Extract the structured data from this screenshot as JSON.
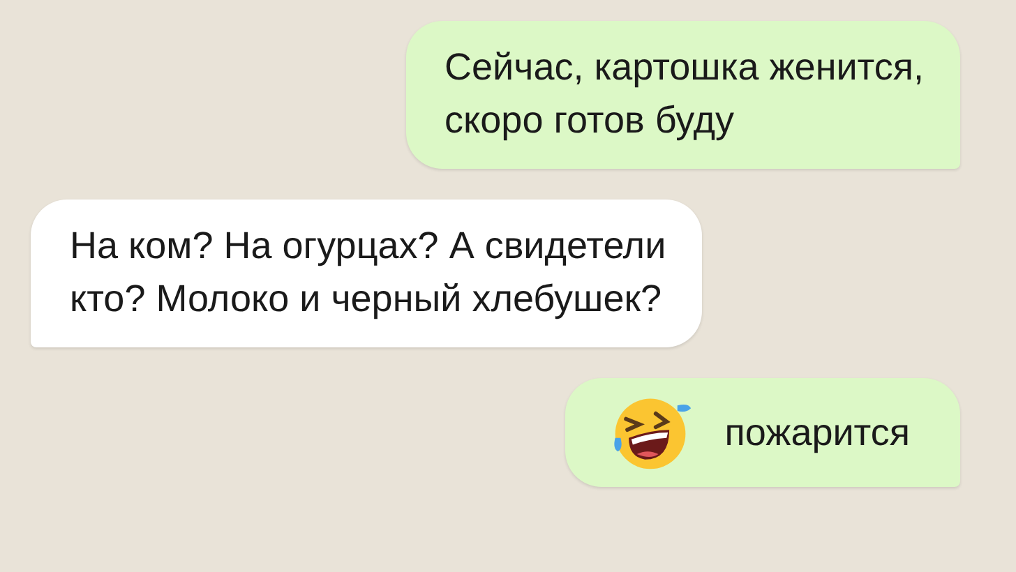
{
  "messages": [
    {
      "kind": "out",
      "text": "Сейчас, картошка женится,\nскоро готов буду",
      "emoji": false
    },
    {
      "kind": "in",
      "text": "На ком? На огурцах? А свидетели\nкто? Молоко и черный хлебушек?",
      "emoji": false
    },
    {
      "kind": "out",
      "text": "пожарится",
      "emoji": true
    }
  ]
}
